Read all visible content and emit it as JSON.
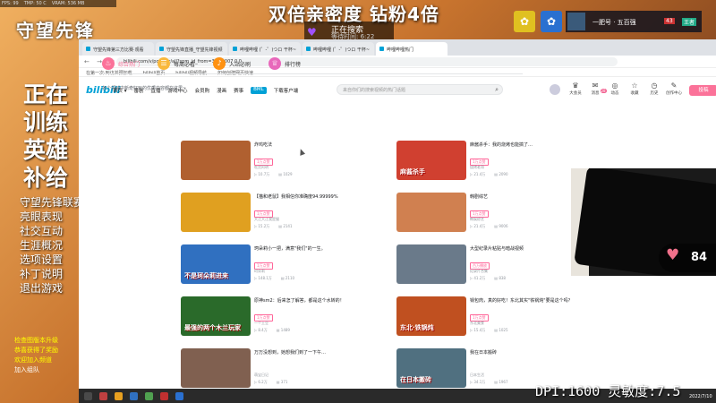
{
  "game": {
    "stats": [
      "FPS: 99",
      "TMP: 50 C",
      "VRAM: 536 MB"
    ],
    "logo": "守望先锋",
    "menu_big": [
      "正在",
      "训练",
      "英雄",
      "补给"
    ],
    "menu_small": [
      "守望先锋联赛",
      "亮眼表现",
      "社交互动",
      "生涯概况",
      "选项设置",
      "补丁说明",
      "退出游戏"
    ],
    "chat": [
      {
        "text": "检查图版本升级",
        "style": "y"
      },
      {
        "text": "恭喜获得了奖励",
        "style": "y"
      },
      {
        "text": "欢迎加入频道",
        "style": "y"
      },
      {
        "text": "加入组队",
        "style": "w"
      }
    ]
  },
  "stream": {
    "headline": "双倍亲密度  钻粉4倍",
    "search_status": "正在搜索",
    "wait_time": "等待时间: 6:22",
    "viewer_name": "一肥号 · 五百强",
    "viewer_level": "43",
    "viewer_rank": "王者",
    "heart_count": "84",
    "dpi_text": "DPI:1600 灵敏度:7.5"
  },
  "browser": {
    "tabs": [
      {
        "label": "守望先锋第三方比赛·观看",
        "active": false
      },
      {
        "label": "守望先锋直播_守望先锋视频",
        "active": false
      },
      {
        "label": "哔哩哔哩 (゜-゜)つロ 干杯~",
        "active": false
      },
      {
        "label": "哔哩哔哩 (゜-゜)つロ 干杯~",
        "active": false
      },
      {
        "label": "哔哩哔哩热门",
        "active": true
      }
    ],
    "nav_glyphs": "← → ⟳",
    "url": "bilibili.com/v/popular/all?spm_id_from=333.1007.0.0",
    "bookmarks": [
      "在第一次·到访并预加载",
      "bilibili首页",
      "bilibili视频导航",
      "如何创建网页快速"
    ]
  },
  "bili": {
    "logo": "bilibili",
    "nav": [
      "首页 ▾",
      "番剧",
      "直播",
      "游戏中心",
      "会员购",
      "漫画",
      "赛事",
      "下载客户端"
    ],
    "nav_highlight": "BML",
    "search_placeholder": "来自你们的搜索视频的热门话题",
    "right": [
      {
        "icon": "♛",
        "label": "大会员"
      },
      {
        "icon": "✉",
        "label": "消息",
        "badge": "28"
      },
      {
        "icon": "◎",
        "label": "动态"
      },
      {
        "icon": "☆",
        "label": "收藏"
      },
      {
        "icon": "◷",
        "label": "历史"
      },
      {
        "icon": "✎",
        "label": "创作中心"
      }
    ],
    "upload": "投稿",
    "pop_tabs": [
      {
        "icon": "♨",
        "label": "综合热门",
        "color": "#fb7299",
        "active": true
      },
      {
        "icon": "☰",
        "label": "每周必看",
        "color": "#f9b83b",
        "active": false
      },
      {
        "icon": "♪",
        "label": "入站必刷",
        "color": "#ff9212",
        "active": false
      },
      {
        "icon": "♕",
        "label": "排行榜",
        "color": "#e868bb",
        "active": false
      }
    ],
    "subtitle": "各个领域中新奇好玩的优质内容都在这里~",
    "videos": [
      {
        "title": "炸鸡吃法",
        "thumb_text": "",
        "tag": "1万点赞",
        "up": "吃货阿明",
        "views": "10.7万",
        "danmaku": "1029",
        "bg": "#b06030"
      },
      {
        "title": "麻酱杀手：我的烧烤也能搞了…",
        "thumb_text": "麻酱杀手",
        "tag": "1万点赞",
        "up": "烧烤老哥",
        "views": "21.4万",
        "danmaku": "2090",
        "bg": "#d04030"
      },
      {
        "title": "【猫和老鼠】我相信你准确度94.99999%",
        "thumb_text": "",
        "tag": "1万点赞",
        "up": "大江大江我是猫",
        "views": "15.2万",
        "danmaku": "2141",
        "bg": "#e0a020"
      },
      {
        "title": "韩剧综艺",
        "thumb_text": "",
        "tag": "1万点赞",
        "up": "韩娱综艺",
        "views": "21.4万",
        "danmaku": "9006",
        "bg": "#d08050"
      },
      {
        "title": "珂朵莉小一把，满意\"我们\"的一生。",
        "thumb_text": "不是珂朵莉进来",
        "tag": "1万点赞",
        "up": "珂朵莉",
        "views": "148.1万",
        "danmaku": "2110",
        "bg": "#3070c0"
      },
      {
        "title": "大型纪录片粘贴与暗战视频",
        "thumb_text": "",
        "tag": "百万播放",
        "up": "纪录片合集",
        "views": "41.2万",
        "danmaku": "838",
        "bg": "#6a7a8a"
      },
      {
        "title": "原神sm2：后来怎了解答，都是这个水转的！",
        "thumb_text": "最强的两个木兰玩家",
        "tag": "1万点赞",
        "up": "一个土豆",
        "views": "8.4万",
        "danmaku": "1489",
        "bg": "#2a6a2a"
      },
      {
        "title": "锅包肉，真的好吃！东北其实\"铁锅炖\"要是这个吗？",
        "thumb_text": "东北·铁锅炖",
        "tag": "1万点赞",
        "up": "东北美食",
        "views": "15.4万",
        "danmaku": "1025",
        "bg": "#c05020"
      },
      {
        "title": "万万没想到，她想我们到了一下午…",
        "thumb_text": "",
        "tag": "",
        "up": "萌宝日记",
        "views": "6.2万",
        "danmaku": "371",
        "bg": "#806050"
      },
      {
        "title": "我在日本搬砖",
        "thumb_text": "在日本搬砖",
        "tag": "",
        "up": "日本生活",
        "views": "34.1万",
        "danmaku": "1967",
        "bg": "#507080"
      }
    ]
  },
  "taskbar_icons": [
    "#4a4a4a",
    "#c04040",
    "#e8a020",
    "#3070c0",
    "#50a050",
    "#c03030",
    "#2a70d0"
  ],
  "clock": "2022/7/10"
}
